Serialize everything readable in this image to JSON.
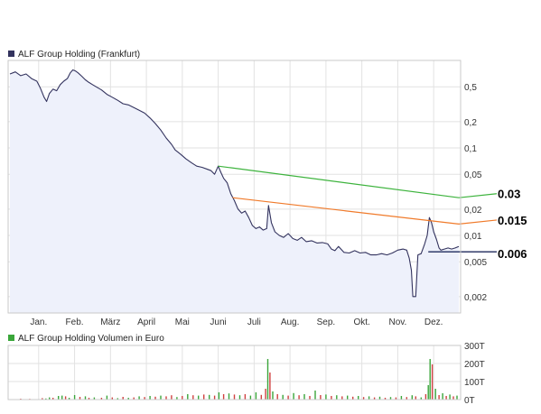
{
  "colors": {
    "price_line": "#33335e",
    "price_fill": "#eef1fb",
    "grid": "#e2e2e2",
    "frame": "#c9c9c9",
    "volume_red": "#d04040",
    "volume_green": "#3aa63a",
    "trend_green": "#3db33d",
    "trend_orange": "#f07a2a",
    "support_navy": "#1f2a5c",
    "legend_volume": "#3aa63a"
  },
  "chart_data": [
    {
      "type": "line",
      "title": "ALF Group Holding (Frankfurt)",
      "xlabel": "",
      "ylabel": "",
      "y_scale": "log",
      "ylim": [
        0.0013,
        1.0
      ],
      "y_ticks": [
        {
          "value": 0.5,
          "label": "0,5"
        },
        {
          "value": 0.2,
          "label": "0,2"
        },
        {
          "value": 0.1,
          "label": "0,1"
        },
        {
          "value": 0.05,
          "label": "0,05"
        },
        {
          "value": 0.02,
          "label": "0,02"
        },
        {
          "value": 0.01,
          "label": "0,01"
        },
        {
          "value": 0.005,
          "label": "0,005"
        },
        {
          "value": 0.002,
          "label": "0,002"
        }
      ],
      "x_range": [
        0,
        12
      ],
      "x_ticks": [
        {
          "value": 0.8,
          "label": "Jan."
        },
        {
          "value": 1.8,
          "label": "Feb."
        },
        {
          "value": 2.8,
          "label": "März"
        },
        {
          "value": 3.8,
          "label": "April"
        },
        {
          "value": 4.8,
          "label": "Mai"
        },
        {
          "value": 5.8,
          "label": "Juni"
        },
        {
          "value": 6.8,
          "label": "Juli"
        },
        {
          "value": 7.8,
          "label": "Aug."
        },
        {
          "value": 8.8,
          "label": "Sep."
        },
        {
          "value": 9.8,
          "label": "Okt."
        },
        {
          "value": 10.8,
          "label": "Nov."
        },
        {
          "value": 11.8,
          "label": "Dez."
        }
      ],
      "grid": true,
      "series": [
        {
          "name": "ALF Group Holding (Frankfurt)",
          "points": [
            [
              0.0,
              0.7
            ],
            [
              0.15,
              0.74
            ],
            [
              0.3,
              0.67
            ],
            [
              0.45,
              0.7
            ],
            [
              0.6,
              0.62
            ],
            [
              0.75,
              0.58
            ],
            [
              0.85,
              0.48
            ],
            [
              0.95,
              0.38
            ],
            [
              1.02,
              0.34
            ],
            [
              1.1,
              0.42
            ],
            [
              1.2,
              0.47
            ],
            [
              1.3,
              0.45
            ],
            [
              1.4,
              0.53
            ],
            [
              1.5,
              0.58
            ],
            [
              1.6,
              0.62
            ],
            [
              1.68,
              0.72
            ],
            [
              1.75,
              0.78
            ],
            [
              1.82,
              0.76
            ],
            [
              1.9,
              0.72
            ],
            [
              2.0,
              0.66
            ],
            [
              2.1,
              0.6
            ],
            [
              2.2,
              0.56
            ],
            [
              2.3,
              0.53
            ],
            [
              2.4,
              0.5
            ],
            [
              2.55,
              0.46
            ],
            [
              2.7,
              0.41
            ],
            [
              2.85,
              0.38
            ],
            [
              3.0,
              0.35
            ],
            [
              3.15,
              0.32
            ],
            [
              3.3,
              0.31
            ],
            [
              3.45,
              0.29
            ],
            [
              3.6,
              0.27
            ],
            [
              3.75,
              0.25
            ],
            [
              3.9,
              0.22
            ],
            [
              4.05,
              0.19
            ],
            [
              4.2,
              0.16
            ],
            [
              4.35,
              0.13
            ],
            [
              4.5,
              0.11
            ],
            [
              4.6,
              0.095
            ],
            [
              4.75,
              0.085
            ],
            [
              4.9,
              0.075
            ],
            [
              5.05,
              0.068
            ],
            [
              5.2,
              0.062
            ],
            [
              5.35,
              0.06
            ],
            [
              5.5,
              0.057
            ],
            [
              5.6,
              0.055
            ],
            [
              5.7,
              0.05
            ],
            [
              5.8,
              0.062
            ],
            [
              5.88,
              0.052
            ],
            [
              5.95,
              0.045
            ],
            [
              6.05,
              0.04
            ],
            [
              6.15,
              0.03
            ],
            [
              6.25,
              0.025
            ],
            [
              6.35,
              0.02
            ],
            [
              6.45,
              0.018
            ],
            [
              6.55,
              0.019
            ],
            [
              6.65,
              0.016
            ],
            [
              6.75,
              0.013
            ],
            [
              6.85,
              0.012
            ],
            [
              6.95,
              0.0125
            ],
            [
              7.05,
              0.0115
            ],
            [
              7.15,
              0.012
            ],
            [
              7.2,
              0.022
            ],
            [
              7.28,
              0.014
            ],
            [
              7.38,
              0.011
            ],
            [
              7.5,
              0.01
            ],
            [
              7.62,
              0.0095
            ],
            [
              7.75,
              0.0105
            ],
            [
              7.88,
              0.0092
            ],
            [
              8.0,
              0.0088
            ],
            [
              8.12,
              0.0095
            ],
            [
              8.25,
              0.0085
            ],
            [
              8.4,
              0.0087
            ],
            [
              8.55,
              0.0082
            ],
            [
              8.7,
              0.0083
            ],
            [
              8.85,
              0.008
            ],
            [
              8.95,
              0.007
            ],
            [
              9.05,
              0.0067
            ],
            [
              9.15,
              0.0075
            ],
            [
              9.3,
              0.0064
            ],
            [
              9.45,
              0.0063
            ],
            [
              9.6,
              0.0067
            ],
            [
              9.75,
              0.0063
            ],
            [
              9.9,
              0.0064
            ],
            [
              10.05,
              0.006
            ],
            [
              10.2,
              0.006
            ],
            [
              10.35,
              0.0062
            ],
            [
              10.5,
              0.006
            ],
            [
              10.65,
              0.0063
            ],
            [
              10.8,
              0.0068
            ],
            [
              10.95,
              0.007
            ],
            [
              11.05,
              0.0068
            ],
            [
              11.12,
              0.0055
            ],
            [
              11.18,
              0.004
            ],
            [
              11.22,
              0.002
            ],
            [
              11.3,
              0.002
            ],
            [
              11.36,
              0.006
            ],
            [
              11.45,
              0.0062
            ],
            [
              11.55,
              0.008
            ],
            [
              11.62,
              0.01
            ],
            [
              11.68,
              0.016
            ],
            [
              11.74,
              0.014
            ],
            [
              11.8,
              0.011
            ],
            [
              11.88,
              0.009
            ],
            [
              11.95,
              0.0072
            ],
            [
              12.0,
              0.0068
            ],
            [
              12.1,
              0.007
            ],
            [
              12.2,
              0.0072
            ],
            [
              12.3,
              0.007
            ],
            [
              12.4,
              0.0072
            ],
            [
              12.5,
              0.0075
            ]
          ]
        }
      ],
      "annotations": [
        {
          "label": "0.03",
          "kind": "trendline",
          "from": [
            5.8,
            0.062
          ],
          "to": [
            12.5,
            0.027
          ],
          "label_value": 0.03,
          "color": "trend_green"
        },
        {
          "label": "0.015",
          "kind": "trendline",
          "from": [
            6.2,
            0.027
          ],
          "to": [
            12.5,
            0.0135
          ],
          "label_value": 0.015,
          "color": "trend_orange"
        },
        {
          "label": "0.006",
          "kind": "level",
          "from": [
            11.65,
            0.0065
          ],
          "to": [
            12.5,
            0.0065
          ],
          "label_value": 0.0062,
          "color": "support_navy"
        }
      ]
    },
    {
      "type": "bar",
      "title": "ALF Group Holding Volumen in Euro",
      "xlabel": "",
      "ylabel": "",
      "ylim": [
        0,
        300
      ],
      "y_ticks": [
        {
          "value": 300,
          "label": "300T"
        },
        {
          "value": 200,
          "label": "200T"
        },
        {
          "value": 100,
          "label": "100T"
        },
        {
          "value": 0,
          "label": "0T"
        }
      ],
      "grid": true,
      "bars": [
        [
          0.3,
          5,
          "r"
        ],
        [
          0.55,
          4,
          "r"
        ],
        [
          0.9,
          8,
          "r"
        ],
        [
          1.0,
          6,
          "g"
        ],
        [
          1.1,
          12,
          "g"
        ],
        [
          1.2,
          10,
          "r"
        ],
        [
          1.35,
          20,
          "g"
        ],
        [
          1.45,
          22,
          "g"
        ],
        [
          1.55,
          18,
          "r"
        ],
        [
          1.65,
          10,
          "g"
        ],
        [
          1.8,
          25,
          "g"
        ],
        [
          1.95,
          15,
          "r"
        ],
        [
          2.1,
          18,
          "g"
        ],
        [
          2.2,
          10,
          "r"
        ],
        [
          2.35,
          12,
          "g"
        ],
        [
          2.55,
          10,
          "r"
        ],
        [
          2.7,
          22,
          "g"
        ],
        [
          2.85,
          12,
          "r"
        ],
        [
          3.0,
          8,
          "g"
        ],
        [
          3.15,
          15,
          "r"
        ],
        [
          3.3,
          10,
          "g"
        ],
        [
          3.45,
          12,
          "r"
        ],
        [
          3.6,
          18,
          "g"
        ],
        [
          3.75,
          14,
          "r"
        ],
        [
          3.9,
          20,
          "g"
        ],
        [
          4.05,
          16,
          "r"
        ],
        [
          4.2,
          22,
          "g"
        ],
        [
          4.35,
          18,
          "r"
        ],
        [
          4.5,
          24,
          "r"
        ],
        [
          4.65,
          14,
          "g"
        ],
        [
          4.8,
          20,
          "r"
        ],
        [
          4.95,
          30,
          "g"
        ],
        [
          5.1,
          24,
          "r"
        ],
        [
          5.25,
          22,
          "g"
        ],
        [
          5.4,
          28,
          "r"
        ],
        [
          5.55,
          26,
          "g"
        ],
        [
          5.7,
          22,
          "r"
        ],
        [
          5.82,
          40,
          "g"
        ],
        [
          5.95,
          30,
          "r"
        ],
        [
          6.1,
          34,
          "g"
        ],
        [
          6.25,
          28,
          "r"
        ],
        [
          6.4,
          24,
          "g"
        ],
        [
          6.55,
          30,
          "r"
        ],
        [
          6.7,
          22,
          "g"
        ],
        [
          6.85,
          40,
          "g"
        ],
        [
          7.0,
          26,
          "r"
        ],
        [
          7.12,
          60,
          "r"
        ],
        [
          7.18,
          225,
          "g"
        ],
        [
          7.24,
          150,
          "r"
        ],
        [
          7.32,
          45,
          "g"
        ],
        [
          7.45,
          30,
          "r"
        ],
        [
          7.6,
          26,
          "g"
        ],
        [
          7.75,
          22,
          "r"
        ],
        [
          7.9,
          36,
          "g"
        ],
        [
          8.05,
          24,
          "r"
        ],
        [
          8.2,
          30,
          "g"
        ],
        [
          8.35,
          20,
          "r"
        ],
        [
          8.5,
          50,
          "g"
        ],
        [
          8.65,
          25,
          "r"
        ],
        [
          8.8,
          28,
          "g"
        ],
        [
          8.95,
          20,
          "r"
        ],
        [
          9.1,
          24,
          "g"
        ],
        [
          9.25,
          18,
          "r"
        ],
        [
          9.4,
          22,
          "g"
        ],
        [
          9.55,
          16,
          "r"
        ],
        [
          9.7,
          20,
          "g"
        ],
        [
          9.85,
          14,
          "r"
        ],
        [
          10.0,
          18,
          "g"
        ],
        [
          10.15,
          12,
          "r"
        ],
        [
          10.3,
          16,
          "g"
        ],
        [
          10.45,
          10,
          "r"
        ],
        [
          10.6,
          14,
          "g"
        ],
        [
          10.75,
          12,
          "r"
        ],
        [
          10.9,
          20,
          "g"
        ],
        [
          11.05,
          14,
          "r"
        ],
        [
          11.2,
          24,
          "g"
        ],
        [
          11.3,
          18,
          "r"
        ],
        [
          11.45,
          12,
          "g"
        ],
        [
          11.58,
          30,
          "r"
        ],
        [
          11.65,
          80,
          "g"
        ],
        [
          11.7,
          225,
          "g"
        ],
        [
          11.76,
          195,
          "r"
        ],
        [
          11.85,
          60,
          "g"
        ],
        [
          11.95,
          25,
          "r"
        ],
        [
          12.05,
          35,
          "g"
        ],
        [
          12.15,
          20,
          "r"
        ],
        [
          12.25,
          28,
          "g"
        ],
        [
          12.35,
          18,
          "r"
        ],
        [
          12.45,
          22,
          "g"
        ]
      ]
    }
  ]
}
